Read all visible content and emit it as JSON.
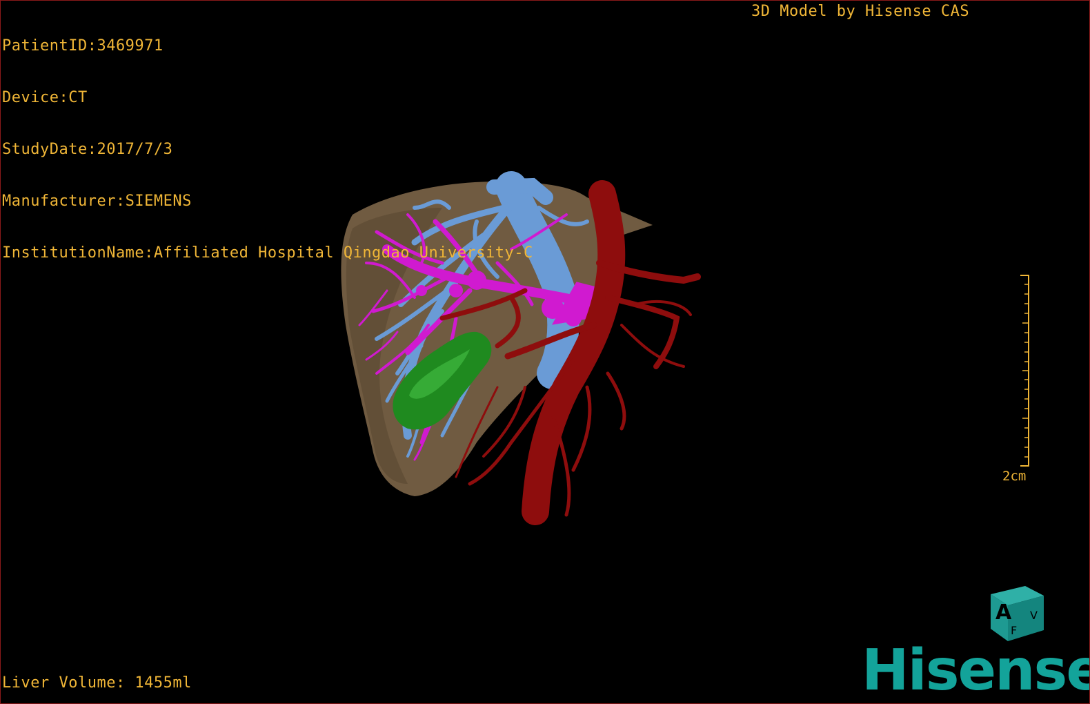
{
  "metadata": {
    "patient_id": "PatientID:3469971",
    "device": "Device:CT",
    "study_date": "StudyDate:2017/7/3",
    "manufacturer": "Manufacturer:SIEMENS",
    "institution": "InstitutionName:Affiliated Hospital Qingdao University-C"
  },
  "credit": "3D Model by Hisense CAS",
  "liver_volume": "Liver Volume: 1455ml",
  "scale": {
    "label": "2cm"
  },
  "orientation_cube": {
    "front_letter": "A",
    "side_letter": "V",
    "bottom_letter": "F"
  },
  "brand": "Hisense",
  "colors": {
    "overlay_text": "#f0b637",
    "liver": "#7a6346",
    "portal_vein": "#6a9bd6",
    "hepatic_vessels": "#d01ad0",
    "artery": "#8e0d0d",
    "gallbladder": "#1f8a1f",
    "brand": "#13a39a"
  }
}
